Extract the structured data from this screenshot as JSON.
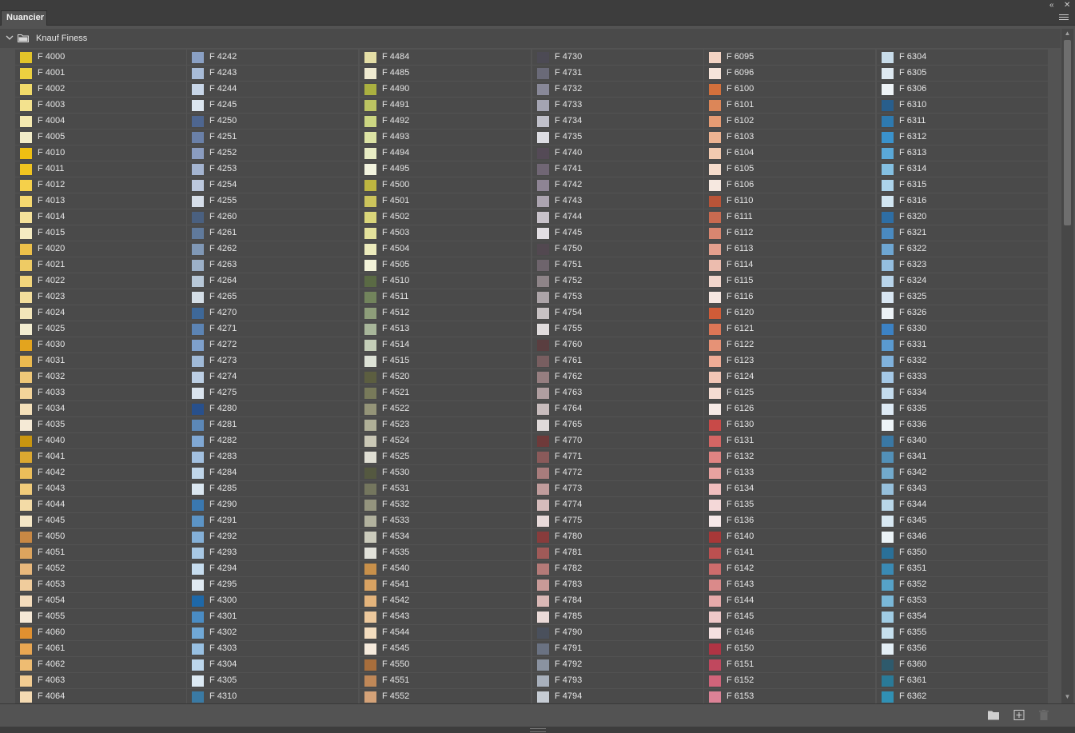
{
  "panel": {
    "tab_label": "Nuancier",
    "group_name": "Knauf Finess"
  },
  "icons": {
    "collapse": "double-chevron-left-icon",
    "close": "close-icon",
    "menu": "hamburger-menu-icon",
    "group_toggle": "chevron-down-icon",
    "group_folder": "folder-icon",
    "new_group": "new-folder-icon",
    "new_swatch": "add-swatch-icon",
    "delete": "trash-icon"
  },
  "columns": [
    [
      {
        "label": "F 4000",
        "color": "#e2c42a"
      },
      {
        "label": "F 4001",
        "color": "#ecd040"
      },
      {
        "label": "F 4002",
        "color": "#f0da6a"
      },
      {
        "label": "F 4003",
        "color": "#f3e28e"
      },
      {
        "label": "F 4004",
        "color": "#f4e9b0"
      },
      {
        "label": "F 4005",
        "color": "#f2ecc8"
      },
      {
        "label": "F 4010",
        "color": "#eebf12"
      },
      {
        "label": "F 4011",
        "color": "#f0c420"
      },
      {
        "label": "F 4012",
        "color": "#f5d04a"
      },
      {
        "label": "F 4013",
        "color": "#f5d870"
      },
      {
        "label": "F 4014",
        "color": "#f5e29a"
      },
      {
        "label": "F 4015",
        "color": "#f4ebc2"
      },
      {
        "label": "F 4020",
        "color": "#ecc04a"
      },
      {
        "label": "F 4021",
        "color": "#eecb64"
      },
      {
        "label": "F 4022",
        "color": "#f2d57c"
      },
      {
        "label": "F 4023",
        "color": "#f3de9c"
      },
      {
        "label": "F 4024",
        "color": "#f3e6ba"
      },
      {
        "label": "F 4025",
        "color": "#f2ecd0"
      },
      {
        "label": "F 4030",
        "color": "#e3a41e"
      },
      {
        "label": "F 4031",
        "color": "#ebba50"
      },
      {
        "label": "F 4032",
        "color": "#f0c878"
      },
      {
        "label": "F 4033",
        "color": "#f3d49a"
      },
      {
        "label": "F 4034",
        "color": "#f4e0ba"
      },
      {
        "label": "F 4035",
        "color": "#f5ead6"
      },
      {
        "label": "F 4040",
        "color": "#c89510"
      },
      {
        "label": "F 4041",
        "color": "#dca830"
      },
      {
        "label": "F 4042",
        "color": "#ecbe5a"
      },
      {
        "label": "F 4043",
        "color": "#f0cb7a"
      },
      {
        "label": "F 4044",
        "color": "#f3dba6"
      },
      {
        "label": "F 4045",
        "color": "#f4e6c6"
      },
      {
        "label": "F 4050",
        "color": "#c88844"
      },
      {
        "label": "F 4051",
        "color": "#dca45e"
      },
      {
        "label": "F 4052",
        "color": "#e8b87c"
      },
      {
        "label": "F 4053",
        "color": "#f0cc9c"
      },
      {
        "label": "F 4054",
        "color": "#f4dcbc"
      },
      {
        "label": "F 4055",
        "color": "#f5e8d6"
      },
      {
        "label": "F 4060",
        "color": "#e09030"
      },
      {
        "label": "F 4061",
        "color": "#e8a652"
      },
      {
        "label": "F 4062",
        "color": "#eebc72"
      },
      {
        "label": "F 4063",
        "color": "#f2cc92"
      },
      {
        "label": "F 4064",
        "color": "#f4dab2"
      }
    ],
    [
      {
        "label": "F 4242",
        "color": "#8aa0c4"
      },
      {
        "label": "F 4243",
        "color": "#a8bcd8"
      },
      {
        "label": "F 4244",
        "color": "#c8d6e8"
      },
      {
        "label": "F 4245",
        "color": "#dce6f0"
      },
      {
        "label": "F 4250",
        "color": "#4e6690"
      },
      {
        "label": "F 4251",
        "color": "#6a80a8"
      },
      {
        "label": "F 4252",
        "color": "#8a9cc0"
      },
      {
        "label": "F 4253",
        "color": "#a4b4d0"
      },
      {
        "label": "F 4254",
        "color": "#bcc8de"
      },
      {
        "label": "F 4255",
        "color": "#d6dee9"
      },
      {
        "label": "F 4260",
        "color": "#4a6080"
      },
      {
        "label": "F 4261",
        "color": "#607a9c"
      },
      {
        "label": "F 4262",
        "color": "#8098b6"
      },
      {
        "label": "F 4263",
        "color": "#9cb0c8"
      },
      {
        "label": "F 4264",
        "color": "#b8c8d8"
      },
      {
        "label": "F 4265",
        "color": "#d4dee6"
      },
      {
        "label": "F 4270",
        "color": "#3e6898"
      },
      {
        "label": "F 4271",
        "color": "#5c84b4"
      },
      {
        "label": "F 4272",
        "color": "#7ea0cc"
      },
      {
        "label": "F 4273",
        "color": "#a0bad8"
      },
      {
        "label": "F 4274",
        "color": "#bccfe4"
      },
      {
        "label": "F 4275",
        "color": "#dae4ee"
      },
      {
        "label": "F 4280",
        "color": "#28508c"
      },
      {
        "label": "F 4281",
        "color": "#5c88b8"
      },
      {
        "label": "F 4282",
        "color": "#80a8d4"
      },
      {
        "label": "F 4283",
        "color": "#a2c0e0"
      },
      {
        "label": "F 4284",
        "color": "#c0d6ea"
      },
      {
        "label": "F 4285",
        "color": "#dae6f0"
      },
      {
        "label": "F 4290",
        "color": "#3a78b0"
      },
      {
        "label": "F 4291",
        "color": "#5c94c6"
      },
      {
        "label": "F 4292",
        "color": "#84b0d8"
      },
      {
        "label": "F 4293",
        "color": "#a8c8e4"
      },
      {
        "label": "F 4294",
        "color": "#c6dcee"
      },
      {
        "label": "F 4295",
        "color": "#e0eaf2"
      },
      {
        "label": "F 4300",
        "color": "#1e68a8"
      },
      {
        "label": "F 4301",
        "color": "#4a8cc4"
      },
      {
        "label": "F 4302",
        "color": "#70a8d6"
      },
      {
        "label": "F 4303",
        "color": "#98c0e2"
      },
      {
        "label": "F 4304",
        "color": "#bcd6ec"
      },
      {
        "label": "F 4305",
        "color": "#dce9f3"
      },
      {
        "label": "F 4310",
        "color": "#3a7aa4"
      }
    ],
    [
      {
        "label": "F 4484",
        "color": "#e4dea6"
      },
      {
        "label": "F 4485",
        "color": "#eeead0"
      },
      {
        "label": "F 4490",
        "color": "#aab040"
      },
      {
        "label": "F 4491",
        "color": "#bcc462"
      },
      {
        "label": "F 4492",
        "color": "#ccd682"
      },
      {
        "label": "F 4493",
        "color": "#dce3a4"
      },
      {
        "label": "F 4494",
        "color": "#e8ecc4"
      },
      {
        "label": "F 4495",
        "color": "#f2f3de"
      },
      {
        "label": "F 4500",
        "color": "#beb640"
      },
      {
        "label": "F 4501",
        "color": "#ccc45c"
      },
      {
        "label": "F 4502",
        "color": "#dad67a"
      },
      {
        "label": "F 4503",
        "color": "#e4e29c"
      },
      {
        "label": "F 4504",
        "color": "#ecebbc"
      },
      {
        "label": "F 4505",
        "color": "#f2f2d8"
      },
      {
        "label": "F 4510",
        "color": "#5a6a44"
      },
      {
        "label": "F 4511",
        "color": "#72845c"
      },
      {
        "label": "F 4512",
        "color": "#8e9e7a"
      },
      {
        "label": "F 4513",
        "color": "#a8b69a"
      },
      {
        "label": "F 4514",
        "color": "#c4ceb8"
      },
      {
        "label": "F 4515",
        "color": "#dde2d6"
      },
      {
        "label": "F 4520",
        "color": "#5c5e40"
      },
      {
        "label": "F 4521",
        "color": "#787a5a"
      },
      {
        "label": "F 4522",
        "color": "#949478"
      },
      {
        "label": "F 4523",
        "color": "#b0b098"
      },
      {
        "label": "F 4524",
        "color": "#cac8b6"
      },
      {
        "label": "F 4525",
        "color": "#e0dfd4"
      },
      {
        "label": "F 4530",
        "color": "#545840"
      },
      {
        "label": "F 4531",
        "color": "#74765e"
      },
      {
        "label": "F 4532",
        "color": "#94947e"
      },
      {
        "label": "F 4533",
        "color": "#b2b29e"
      },
      {
        "label": "F 4534",
        "color": "#cbcbbc"
      },
      {
        "label": "F 4535",
        "color": "#e2e2da"
      },
      {
        "label": "F 4540",
        "color": "#c8904a"
      },
      {
        "label": "F 4541",
        "color": "#d8a262"
      },
      {
        "label": "F 4542",
        "color": "#e4b47c"
      },
      {
        "label": "F 4543",
        "color": "#ecc89c"
      },
      {
        "label": "F 4544",
        "color": "#f2dcbe"
      },
      {
        "label": "F 4545",
        "color": "#f5eadc"
      },
      {
        "label": "F 4550",
        "color": "#a86e3c"
      },
      {
        "label": "F 4551",
        "color": "#c08858"
      },
      {
        "label": "F 4552",
        "color": "#d4a278"
      }
    ],
    [
      {
        "label": "F 4730",
        "color": "#4c4a54"
      },
      {
        "label": "F 4731",
        "color": "#6a6a78"
      },
      {
        "label": "F 4732",
        "color": "#888898"
      },
      {
        "label": "F 4733",
        "color": "#a4a4b2"
      },
      {
        "label": "F 4734",
        "color": "#c0c0ca"
      },
      {
        "label": "F 4735",
        "color": "#dcdce2"
      },
      {
        "label": "F 4740",
        "color": "#544a56"
      },
      {
        "label": "F 4741",
        "color": "#706674"
      },
      {
        "label": "F 4742",
        "color": "#8e8494"
      },
      {
        "label": "F 4743",
        "color": "#aca4b0"
      },
      {
        "label": "F 4744",
        "color": "#c8c2ca"
      },
      {
        "label": "F 4745",
        "color": "#e2dee3"
      },
      {
        "label": "F 4750",
        "color": "#524850"
      },
      {
        "label": "F 4751",
        "color": "#6e646c"
      },
      {
        "label": "F 4752",
        "color": "#8e8488"
      },
      {
        "label": "F 4753",
        "color": "#aca4a8"
      },
      {
        "label": "F 4754",
        "color": "#c8c2c4"
      },
      {
        "label": "F 4755",
        "color": "#e0dcdd"
      },
      {
        "label": "F 4760",
        "color": "#5a3e40"
      },
      {
        "label": "F 4761",
        "color": "#785e60"
      },
      {
        "label": "F 4762",
        "color": "#967e80"
      },
      {
        "label": "F 4763",
        "color": "#b09ea0"
      },
      {
        "label": "F 4764",
        "color": "#c8bcbd"
      },
      {
        "label": "F 4765",
        "color": "#e0dada"
      },
      {
        "label": "F 4770",
        "color": "#6e3a3a"
      },
      {
        "label": "F 4771",
        "color": "#8a5a5a"
      },
      {
        "label": "F 4772",
        "color": "#a87c7c"
      },
      {
        "label": "F 4773",
        "color": "#c09c9c"
      },
      {
        "label": "F 4774",
        "color": "#d6bcbc"
      },
      {
        "label": "F 4775",
        "color": "#e8dada"
      },
      {
        "label": "F 4780",
        "color": "#883c3c"
      },
      {
        "label": "F 4781",
        "color": "#a05a58"
      },
      {
        "label": "F 4782",
        "color": "#b47a78"
      },
      {
        "label": "F 4783",
        "color": "#c89a98"
      },
      {
        "label": "F 4784",
        "color": "#dab8b6"
      },
      {
        "label": "F 4785",
        "color": "#eadad8"
      },
      {
        "label": "F 4790",
        "color": "#4a505c"
      },
      {
        "label": "F 4791",
        "color": "#6a7282"
      },
      {
        "label": "F 4792",
        "color": "#8a92a0"
      },
      {
        "label": "F 4793",
        "color": "#a8b0bc"
      },
      {
        "label": "F 4794",
        "color": "#c6ccd4"
      }
    ],
    [
      {
        "label": "F 6095",
        "color": "#f4d4c4"
      },
      {
        "label": "F 6096",
        "color": "#f6e4da"
      },
      {
        "label": "F 6100",
        "color": "#d2703c"
      },
      {
        "label": "F 6101",
        "color": "#dc8658"
      },
      {
        "label": "F 6102",
        "color": "#e69c74"
      },
      {
        "label": "F 6103",
        "color": "#eeb492"
      },
      {
        "label": "F 6104",
        "color": "#f2cab0"
      },
      {
        "label": "F 6105",
        "color": "#f5dccc"
      },
      {
        "label": "F 6106",
        "color": "#f6e8e0"
      },
      {
        "label": "F 6110",
        "color": "#b85438"
      },
      {
        "label": "F 6111",
        "color": "#c86a50"
      },
      {
        "label": "F 6112",
        "color": "#d88670"
      },
      {
        "label": "F 6113",
        "color": "#e4a08e"
      },
      {
        "label": "F 6114",
        "color": "#ecbcae"
      },
      {
        "label": "F 6115",
        "color": "#f2d6cc"
      },
      {
        "label": "F 6116",
        "color": "#f5e6e0"
      },
      {
        "label": "F 6120",
        "color": "#d05c38"
      },
      {
        "label": "F 6121",
        "color": "#dc7656"
      },
      {
        "label": "F 6122",
        "color": "#e69276"
      },
      {
        "label": "F 6123",
        "color": "#eeac96"
      },
      {
        "label": "F 6124",
        "color": "#f2c6b6"
      },
      {
        "label": "F 6125",
        "color": "#f5dcd2"
      },
      {
        "label": "F 6126",
        "color": "#f6eae6"
      },
      {
        "label": "F 6130",
        "color": "#c84a48"
      },
      {
        "label": "F 6131",
        "color": "#d46664"
      },
      {
        "label": "F 6132",
        "color": "#e08482"
      },
      {
        "label": "F 6133",
        "color": "#e8a2a0"
      },
      {
        "label": "F 6134",
        "color": "#f0bebe"
      },
      {
        "label": "F 6135",
        "color": "#f4d8d8"
      },
      {
        "label": "F 6136",
        "color": "#f6e8e8"
      },
      {
        "label": "F 6140",
        "color": "#a83838"
      },
      {
        "label": "F 6141",
        "color": "#bc5050"
      },
      {
        "label": "F 6142",
        "color": "#cc6c6c"
      },
      {
        "label": "F 6143",
        "color": "#da8a8a"
      },
      {
        "label": "F 6144",
        "color": "#e6aaaa"
      },
      {
        "label": "F 6145",
        "color": "#eec8c8"
      },
      {
        "label": "F 6146",
        "color": "#f4e0e0"
      },
      {
        "label": "F 6150",
        "color": "#b03444"
      },
      {
        "label": "F 6151",
        "color": "#c0485e"
      },
      {
        "label": "F 6152",
        "color": "#d0647a"
      },
      {
        "label": "F 6153",
        "color": "#dc8296"
      }
    ],
    [
      {
        "label": "F 6304",
        "color": "#c8dcea"
      },
      {
        "label": "F 6305",
        "color": "#dee9f1"
      },
      {
        "label": "F 6306",
        "color": "#eef3f6"
      },
      {
        "label": "F 6310",
        "color": "#285e8c"
      },
      {
        "label": "F 6311",
        "color": "#2e7ab0"
      },
      {
        "label": "F 6312",
        "color": "#3a92cc"
      },
      {
        "label": "F 6313",
        "color": "#5aa8d8"
      },
      {
        "label": "F 6314",
        "color": "#84c0e2"
      },
      {
        "label": "F 6315",
        "color": "#acd4ec"
      },
      {
        "label": "F 6316",
        "color": "#d2e6f2"
      },
      {
        "label": "F 6320",
        "color": "#2e6ea4"
      },
      {
        "label": "F 6321",
        "color": "#4a8ac0"
      },
      {
        "label": "F 6322",
        "color": "#6ea6d2"
      },
      {
        "label": "F 6323",
        "color": "#94beE0"
      },
      {
        "label": "F 6324",
        "color": "#b8d4ea"
      },
      {
        "label": "F 6325",
        "color": "#d8e6f2"
      },
      {
        "label": "F 6326",
        "color": "#ecf2f6"
      },
      {
        "label": "F 6330",
        "color": "#3c82c4"
      },
      {
        "label": "F 6331",
        "color": "#5a9ad0"
      },
      {
        "label": "F 6332",
        "color": "#80b2dc"
      },
      {
        "label": "F 6333",
        "color": "#a4c8e6"
      },
      {
        "label": "F 6334",
        "color": "#c4dcee"
      },
      {
        "label": "F 6335",
        "color": "#deeaf4"
      },
      {
        "label": "F 6336",
        "color": "#eef4f8"
      },
      {
        "label": "F 6340",
        "color": "#3a78a4"
      },
      {
        "label": "F 6341",
        "color": "#5290b8"
      },
      {
        "label": "F 6342",
        "color": "#72aacc"
      },
      {
        "label": "F 6343",
        "color": "#96c0dc"
      },
      {
        "label": "F 6344",
        "color": "#b8d6e8"
      },
      {
        "label": "F 6345",
        "color": "#d8e8f2"
      },
      {
        "label": "F 6346",
        "color": "#ecf3f7"
      },
      {
        "label": "F 6350",
        "color": "#2a7098"
      },
      {
        "label": "F 6351",
        "color": "#3a8ab4"
      },
      {
        "label": "F 6352",
        "color": "#56a2c8"
      },
      {
        "label": "F 6353",
        "color": "#7ab8d8"
      },
      {
        "label": "F 6354",
        "color": "#a0cce4"
      },
      {
        "label": "F 6355",
        "color": "#c6e0ee"
      },
      {
        "label": "F 6356",
        "color": "#e4eff6"
      },
      {
        "label": "F 6360",
        "color": "#2e5a6c"
      },
      {
        "label": "F 6361",
        "color": "#2a7a98"
      },
      {
        "label": "F 6362",
        "color": "#3090b4"
      }
    ]
  ]
}
